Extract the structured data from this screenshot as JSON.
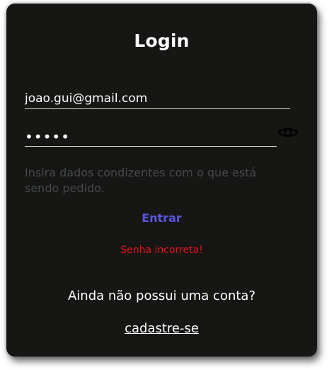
{
  "login": {
    "title": "Login",
    "email_value": "joao.gui@gmail.com",
    "password_value": "12345",
    "password_toggle_icon": "eye-icon",
    "hint": "Insira dados condizentes com o que está sendo pedido.",
    "submit_label": "Entrar",
    "error_message": "Senha incorreta!",
    "no_account_text": "Ainda não possui uma conta?",
    "signup_link": "cadastre-se"
  },
  "colors": {
    "card_background": "#161614",
    "submit_text": "#5b55e0",
    "error_text": "#e5121b",
    "hint_text": "#44494e"
  }
}
